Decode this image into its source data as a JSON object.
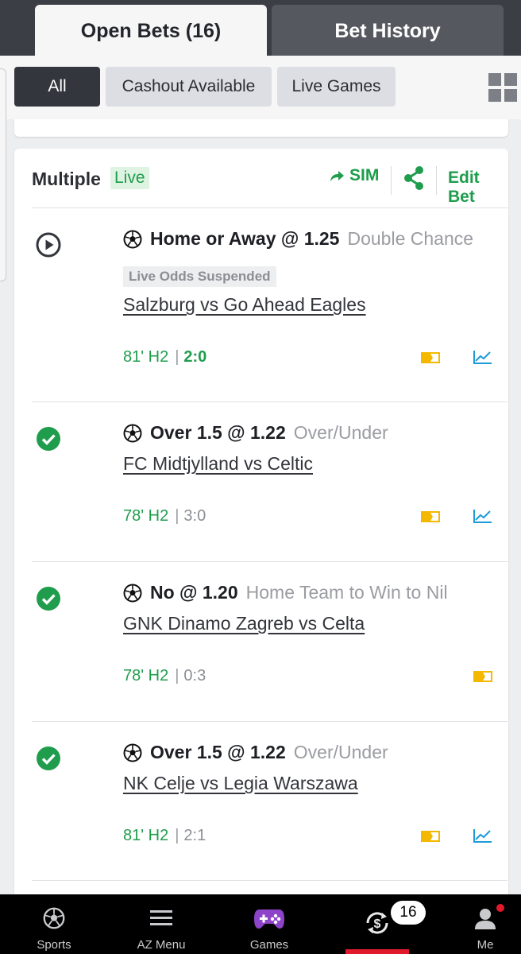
{
  "tabs": [
    {
      "label": "Open Bets (16)",
      "active": true
    },
    {
      "label": "Bet History",
      "active": false
    }
  ],
  "filters": [
    {
      "label": "All",
      "active": true
    },
    {
      "label": "Cashout Available",
      "active": false
    },
    {
      "label": "Live Games",
      "active": false
    }
  ],
  "bet": {
    "type": "Multiple",
    "live_badge": "Live",
    "sim_label": "SIM",
    "edit_label": "Edit Bet",
    "legs": [
      {
        "status": "play-icon",
        "selection": "Home or Away @ 1.25",
        "market": "Double Chance",
        "suspended": "Live Odds Suspended",
        "event": "Salzburg vs Go Ahead Eagles",
        "time": "81' H2",
        "score": "2:0",
        "score_live": true,
        "icons": [
          "tag-icon",
          "chart-icon"
        ]
      },
      {
        "status": "check-icon",
        "selection": "Over 1.5 @ 1.22",
        "market": "Over/Under",
        "event": "FC Midtjylland vs Celtic",
        "time": "78' H2",
        "score": "3:0",
        "score_live": false,
        "icons": [
          "tag-icon",
          "chart-icon"
        ]
      },
      {
        "status": "check-icon",
        "selection": "No @ 1.20",
        "market": "Home Team to Win to Nil",
        "event": "GNK Dinamo Zagreb vs Celta",
        "time": "78' H2",
        "score": "0:3",
        "score_live": false,
        "icons": [
          "tag-icon"
        ]
      },
      {
        "status": "check-icon",
        "selection": "Over 1.5 @ 1.22",
        "market": "Over/Under",
        "event": "NK Celje vs Legia Warszawa",
        "time": "81' H2",
        "score": "2:1",
        "score_live": false,
        "icons": [
          "tag-icon",
          "chart-icon"
        ]
      }
    ]
  },
  "bottom_nav": [
    {
      "label": "Sports",
      "icon": "soccer-ball-icon"
    },
    {
      "label": "AZ Menu",
      "icon": "menu-icon"
    },
    {
      "label": "Games",
      "icon": "gamepad-icon"
    },
    {
      "label": "",
      "icon": "cashout-icon",
      "badge": "16",
      "active": true
    },
    {
      "label": "Me",
      "icon": "user-icon"
    }
  ],
  "colors": {
    "accent_green": "#1f9d4d",
    "dark_header": "#3b3e45",
    "tag_yellow": "#f5b800",
    "chart_blue": "#1e9bd7",
    "active_red": "#e01a2b"
  }
}
